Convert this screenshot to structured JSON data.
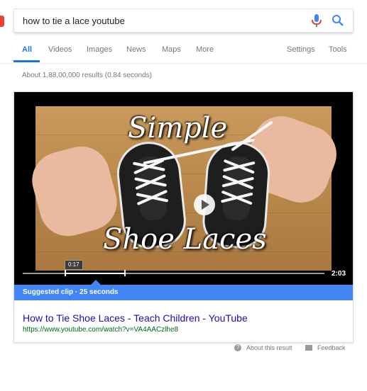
{
  "search": {
    "query": "how to tie a lace youtube"
  },
  "tabs": [
    {
      "label": "All",
      "active": true
    },
    {
      "label": "Videos"
    },
    {
      "label": "Images"
    },
    {
      "label": "News"
    },
    {
      "label": "Maps"
    },
    {
      "label": "More"
    }
  ],
  "tools": {
    "settings": "Settings",
    "tools": "Tools"
  },
  "result_stats": "About 1,88,00,000 results (0.84 seconds)",
  "featured": {
    "thumbnail_title_line1": "Simple",
    "thumbnail_title_line2": "Shoe Laces",
    "clip_timestamp": "0:17",
    "duration": "2:03",
    "suggested_clip": "Suggested clip · 25 seconds",
    "title": "How to Tie Shoe Laces - Teach Children - YouTube",
    "url": "https://www.youtube.com/watch?v=VA4AACzlhe8"
  },
  "footer": {
    "about": "About this result",
    "feedback": "Feedback"
  },
  "colors": {
    "accent": "#1a73e8",
    "link": "#1a0dab",
    "url": "#006621",
    "suggested_bar": "#4285f4"
  }
}
